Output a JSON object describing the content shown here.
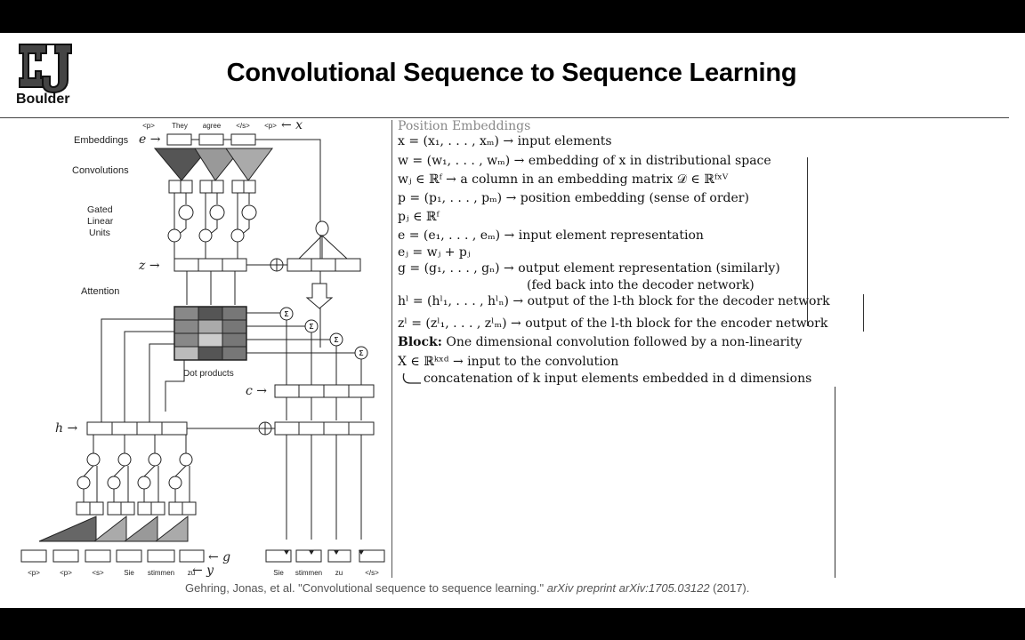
{
  "header": {
    "logo_text": "Boulder",
    "title": "Convolutional Sequence to Sequence Learning"
  },
  "diagram": {
    "source_tokens": [
      "<p>",
      "They",
      "agree",
      "</s>",
      "<p>"
    ],
    "x_label": "← x",
    "labels": {
      "embeddings": "Embeddings",
      "convolutions": "Convolutions",
      "glu_1": "Gated",
      "glu_2": "Linear",
      "glu_3": "Units",
      "attention": "Attention",
      "dot_products": "Dot products"
    },
    "var_e": "e →",
    "var_z": "z →",
    "var_h": "h →",
    "var_c": "c →",
    "var_g": "← g",
    "var_y": "← y",
    "target_tokens": [
      "<p>",
      "<p>",
      "<s>",
      "Sie",
      "stimmen",
      "zu"
    ],
    "output_tokens": [
      "Sie",
      "stimmen",
      "zu",
      "</s>"
    ],
    "sigma": "Σ"
  },
  "notes": {
    "heading": "Position Embeddings",
    "l1": "x = (x₁, . . . , xₘ) → input elements",
    "l2": "w = (w₁, . . . , wₘ) → embedding of x in distributional space",
    "l3": "wⱼ ∈ ℝᶠ → a column in an embedding matrix 𝒟 ∈ ℝᶠˣⱽ",
    "l4": "p = (p₁, . . . , pₘ) → position embedding (sense of order)",
    "l5": "pⱼ ∈ ℝᶠ",
    "l6": "e = (e₁, . . . , eₘ) → input element representation",
    "l7": "eⱼ = wⱼ + pⱼ",
    "l8": "g = (g₁, . . . , gₙ) → output element representation (similarly)",
    "l9": "(fed back into the decoder network)",
    "l10": "hˡ = (hˡ₁, . . . , hˡₙ) → output of the l-th block for the decoder network",
    "l11": "zˡ = (zˡ₁, . . . , zˡₘ) → output of the l-th block for the encoder network",
    "block_label": "Block:",
    "block_text": " One dimensional convolution followed by a non-linearity",
    "l13": "X ∈ ℝᵏˣᵈ → input to the convolution",
    "l14": "concatenation of k input elements embedded in d dimensions"
  },
  "citation": {
    "authors": "Gehring, Jonas, et al. \"Convolutional sequence to sequence learning.\" ",
    "venue": "arXiv preprint arXiv:1705.03122",
    "year": " (2017)."
  }
}
